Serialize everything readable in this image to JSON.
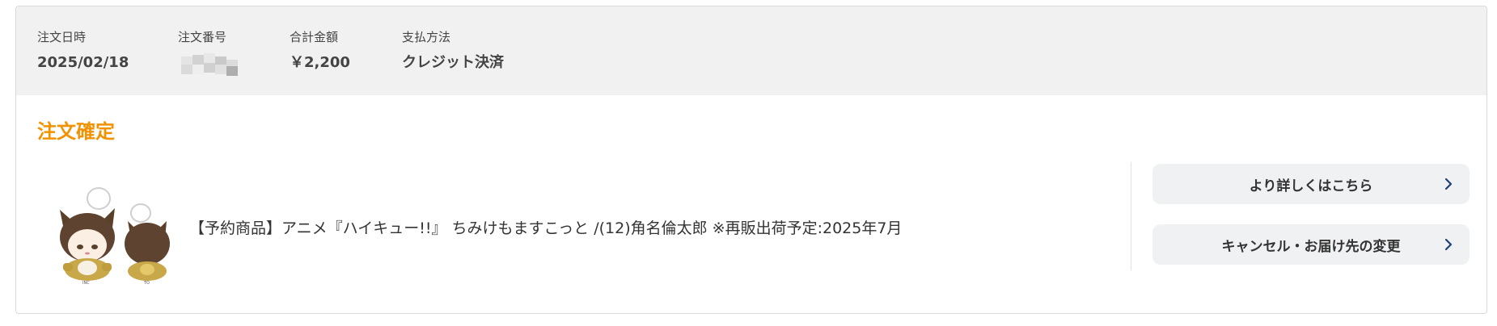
{
  "order_summary": {
    "date_label": "注文日時",
    "date_value": "2025/02/18",
    "number_label": "注文番号",
    "total_label": "合計金額",
    "total_value": "￥2,200",
    "payment_label": "支払方法",
    "payment_value": "クレジット決済"
  },
  "status": {
    "text": "注文確定",
    "color": "#f39200"
  },
  "product": {
    "name": "【予約商品】アニメ『ハイキュー!!』 ちみけもますこっと /(12)角名倫太郎 ※再販出荷予定:2025年7月",
    "image_icon": "product-thumbnail"
  },
  "actions": {
    "details_label": "より詳しくはこちら",
    "change_label": "キャンセル・お届け先の変更",
    "chevron_color": "#1f3f75"
  }
}
